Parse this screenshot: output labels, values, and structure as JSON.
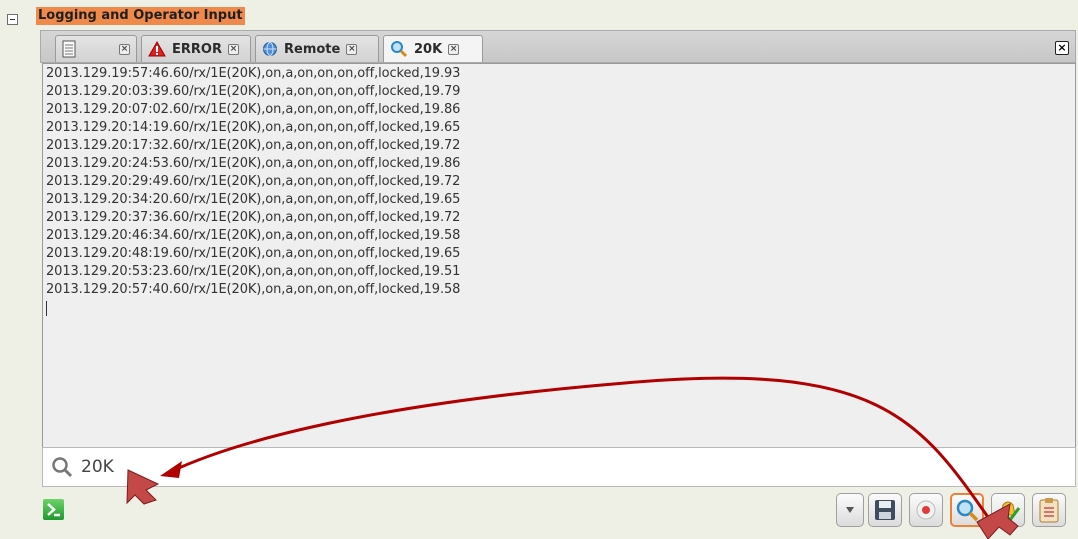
{
  "section": {
    "title": "Logging and Operator Input"
  },
  "tabs": [
    {
      "label": ""
    },
    {
      "label": "ERROR"
    },
    {
      "label": "Remote"
    },
    {
      "label": "20K"
    }
  ],
  "log": {
    "lines": [
      "2013.129.19:57:46.60/rx/1E(20K),on,a,on,on,on,off,locked,19.93",
      "2013.129.20:03:39.60/rx/1E(20K),on,a,on,on,on,off,locked,19.79",
      "2013.129.20:07:02.60/rx/1E(20K),on,a,on,on,on,off,locked,19.86",
      "2013.129.20:14:19.60/rx/1E(20K),on,a,on,on,on,off,locked,19.65",
      "2013.129.20:17:32.60/rx/1E(20K),on,a,on,on,on,off,locked,19.72",
      "2013.129.20:24:53.60/rx/1E(20K),on,a,on,on,on,off,locked,19.86",
      "2013.129.20:29:49.60/rx/1E(20K),on,a,on,on,on,off,locked,19.72",
      "2013.129.20:34:20.60/rx/1E(20K),on,a,on,on,on,off,locked,19.65",
      "2013.129.20:37:36.60/rx/1E(20K),on,a,on,on,on,off,locked,19.72",
      "2013.129.20:46:34.60/rx/1E(20K),on,a,on,on,on,off,locked,19.58",
      "2013.129.20:48:19.60/rx/1E(20K),on,a,on,on,on,off,locked,19.65",
      "2013.129.20:53:23.60/rx/1E(20K),on,a,on,on,on,off,locked,19.51",
      "2013.129.20:57:40.60/rx/1E(20K),on,a,on,on,on,off,locked,19.58"
    ]
  },
  "search": {
    "value": "20K",
    "icon": "magnifier-icon"
  },
  "toolbar": {
    "buttons": [
      "dropdown-icon",
      "save-icon",
      "record-icon",
      "search-icon",
      "bell-check-icon",
      "clipboard-icon"
    ]
  },
  "colors": {
    "accent": "#f08a4b",
    "annotation_arrow": "#b00000"
  }
}
